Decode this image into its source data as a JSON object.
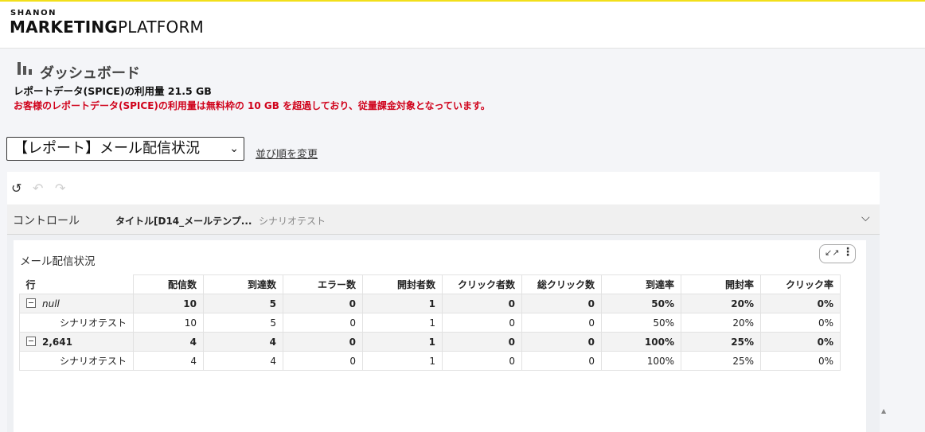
{
  "header": {
    "logo_top": "SHANON",
    "logo_bold": "MARKETING",
    "logo_light": "PLATFORM"
  },
  "dashboard": {
    "title": "ダッシュボード",
    "usage": "レポートデータ(SPICE)の利用量 21.5 GB",
    "warning": "お客様のレポートデータ(SPICE)の利用量は無料枠の 10 GB を超過しており、従量課金対象となっています。"
  },
  "report_select": {
    "value": "【レポート】メール配信状況",
    "reorder_link": "並び順を変更"
  },
  "controls": {
    "label": "コントロール",
    "value": "タイトル[D14_メールテンプ...",
    "scenario": "シナリオテスト"
  },
  "visual": {
    "title": "メール配信状況"
  },
  "table": {
    "row_header": "行",
    "columns": [
      "配信数",
      "到達数",
      "エラー数",
      "開封者数",
      "クリック者数",
      "総クリック数",
      "到達率",
      "開封率",
      "クリック率"
    ],
    "rows": [
      {
        "type": "group",
        "label": "null",
        "values": [
          "10",
          "5",
          "0",
          "1",
          "0",
          "0",
          "50%",
          "20%",
          "0%"
        ]
      },
      {
        "type": "child",
        "label": "シナリオテスト",
        "values": [
          "10",
          "5",
          "0",
          "1",
          "0",
          "0",
          "50%",
          "20%",
          "0%"
        ]
      },
      {
        "type": "group",
        "label": "2,641",
        "values": [
          "4",
          "4",
          "0",
          "1",
          "0",
          "0",
          "100%",
          "25%",
          "0%"
        ]
      },
      {
        "type": "child",
        "label": "シナリオテスト",
        "values": [
          "4",
          "4",
          "0",
          "1",
          "0",
          "0",
          "100%",
          "25%",
          "0%"
        ]
      }
    ]
  },
  "colors": {
    "accent_line": "#f2df1a",
    "warning": "#d0021b"
  }
}
